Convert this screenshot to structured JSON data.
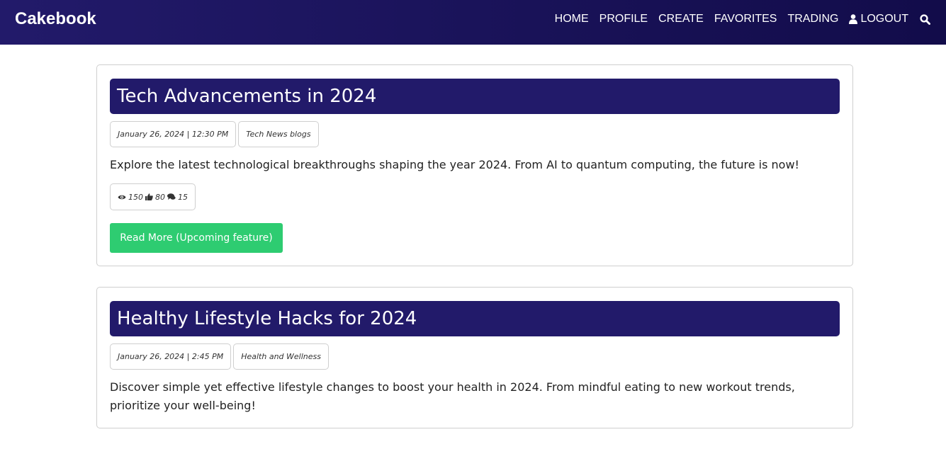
{
  "brand": "Cakebook",
  "nav": {
    "home": "HOME",
    "profile": "PROFILE",
    "create": "CREATE",
    "favorites": "FAVORITES",
    "trading": "TRADING",
    "logout": "LOGOUT"
  },
  "icons": {
    "user": "user-icon",
    "search": "search-icon",
    "eye": "eye-icon",
    "thumbs_up": "thumbs-up-icon",
    "comment": "comment-icon"
  },
  "colors": {
    "navbar": "#1a1258",
    "title_bg": "#221a6a",
    "button": "#2ecc71"
  },
  "posts": [
    {
      "title": "Tech Advancements in 2024",
      "datetime": "January 26, 2024 | 12:30 PM",
      "category": "Tech News blogs",
      "description": "Explore the latest technological breakthroughs shaping the year 2024. From AI to quantum computing, the future is now!",
      "views": "150",
      "likes": "80",
      "comments": "15",
      "button": "Read More (Upcoming feature)"
    },
    {
      "title": "Healthy Lifestyle Hacks for 2024",
      "datetime": "January 26, 2024 | 2:45 PM",
      "category": "Health and Wellness",
      "description": "Discover simple yet effective lifestyle changes to boost your health in 2024. From mindful eating to new workout trends, prioritize your well-being!"
    }
  ]
}
